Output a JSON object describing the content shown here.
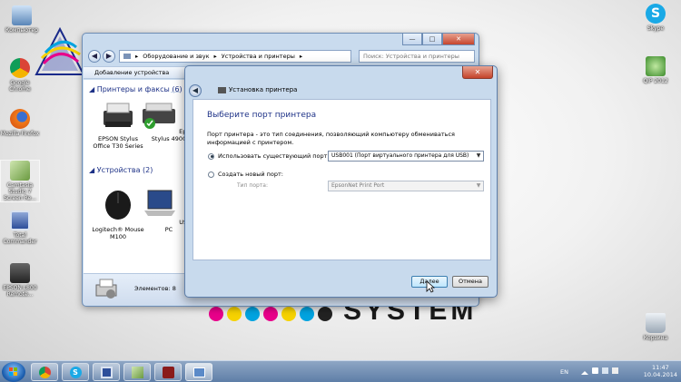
{
  "desktop": {
    "brand_text": "SYSTEM",
    "logo_text": "SYSTEM",
    "icons": [
      {
        "label": "Компьютер",
        "icon": "computer-icon"
      },
      {
        "label": "Google Chrome",
        "icon": "chrome-icon"
      },
      {
        "label": "Mozilla Firefox",
        "icon": "firefox-icon"
      },
      {
        "label": "Camtasia Studio 7 Screen Re...",
        "icon": "camtasia-icon"
      },
      {
        "label": "Total Commander",
        "icon": "floppy-icon"
      },
      {
        "label": "EPSON L800 Remote...",
        "icon": "printer-icon"
      },
      {
        "label": "Skype",
        "icon": "skype-icon"
      },
      {
        "label": "QIP 2012",
        "icon": "qip-icon"
      },
      {
        "label": "Корзина",
        "icon": "recycle-bin-icon"
      }
    ]
  },
  "explorer": {
    "breadcrumb": [
      "Оборудование и звук",
      "Устройства и принтеры"
    ],
    "search_placeholder": "Поиск: Устройства и принтеры",
    "toolbar_label": "Добавление устройства",
    "group_printers": "Принтеры и факсы (6)",
    "group_devices": "Устройства (2)",
    "printers": [
      {
        "name": "EPSON Stylus Office T30 Series"
      },
      {
        "name": "Epson Stylus 4900"
      }
    ],
    "devices": [
      {
        "name": "Logitech® Mouse M100"
      },
      {
        "name": "USER-PC"
      }
    ],
    "status_text": "Элементов: 8"
  },
  "dialog": {
    "title": "Установка принтера",
    "heading": "Выберите порт принтера",
    "description": "Порт принтера - это тип соединения, позволяющий компьютеру обмениваться информацией с принтером.",
    "option_existing": "Использовать существующий порт:",
    "existing_port_value": "USB001 (Порт виртуального принтера для USB)",
    "option_new": "Создать новый порт:",
    "port_type_label": "Тип порта:",
    "port_type_value": "EpsonNet Print Port",
    "next_button": "Далее",
    "cancel_button": "Отмена",
    "selected_option": "existing"
  },
  "taskbar": {
    "language": "EN",
    "time": "11:47",
    "date": "10.04.2014",
    "apps": [
      "chrome-icon",
      "skype-icon",
      "floppy-icon",
      "camtasia-icon",
      "capture-icon",
      "remote-desktop-icon"
    ]
  }
}
